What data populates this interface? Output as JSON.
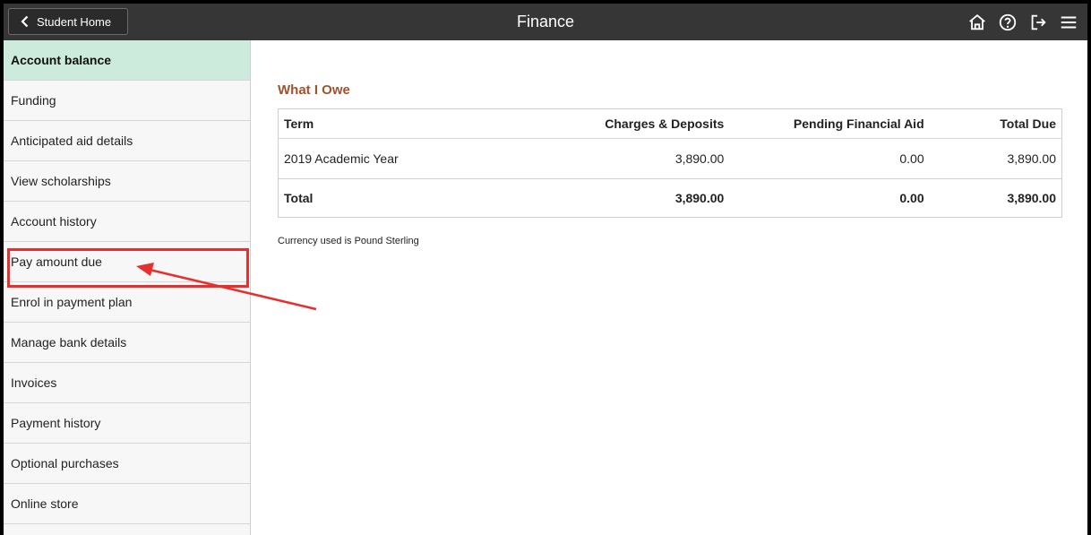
{
  "header": {
    "back_label": "Student Home",
    "title": "Finance",
    "icons": [
      "home-icon",
      "help-icon",
      "sign-out-icon",
      "menu-icon"
    ]
  },
  "sidebar": {
    "items": [
      {
        "label": "Account balance",
        "active": true
      },
      {
        "label": "Funding"
      },
      {
        "label": "Anticipated aid details"
      },
      {
        "label": "View scholarships"
      },
      {
        "label": "Account history"
      },
      {
        "label": "Pay amount due",
        "highlighted": true
      },
      {
        "label": "Enrol in payment plan"
      },
      {
        "label": "Manage bank details"
      },
      {
        "label": "Invoices"
      },
      {
        "label": "Payment history"
      },
      {
        "label": "Optional purchases"
      },
      {
        "label": "Online store"
      }
    ]
  },
  "main": {
    "section_title": "What I Owe",
    "table": {
      "columns": [
        "Term",
        "Charges & Deposits",
        "Pending Financial Aid",
        "Total Due"
      ],
      "rows": [
        [
          "2019 Academic Year",
          "3,890.00",
          "0.00",
          "3,890.00"
        ]
      ],
      "total": [
        "Total",
        "3,890.00",
        "0.00",
        "3,890.00"
      ]
    },
    "currency_note": "Currency used is Pound Sterling"
  },
  "colors": {
    "topbar": "#363636",
    "active_nav": "#cdebdc",
    "section_title": "#a0522d",
    "annotation": "#e53030"
  }
}
